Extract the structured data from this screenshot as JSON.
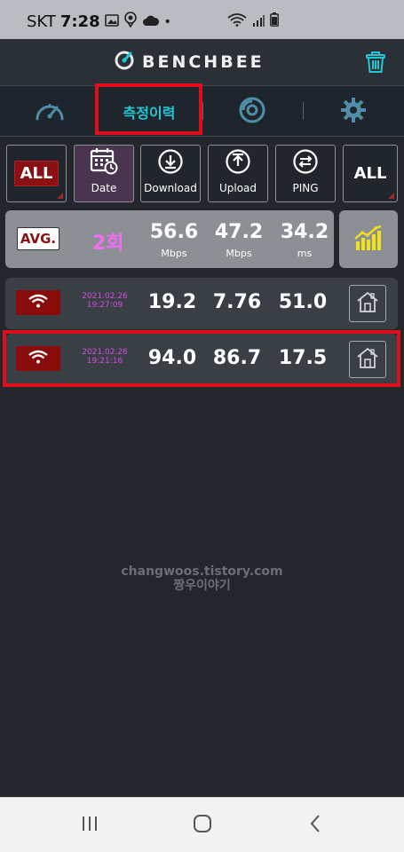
{
  "status_bar": {
    "carrier": "SKT",
    "time": "7:28",
    "dot": "•"
  },
  "app": {
    "logo_text": "BENCHBEE"
  },
  "tabs": {
    "history_label": "측정이력"
  },
  "filters": {
    "all_left": "ALL",
    "date": "Date",
    "download": "Download",
    "upload": "Upload",
    "ping": "PING",
    "all_right": "ALL"
  },
  "average": {
    "badge": "AVG.",
    "count": "2회",
    "download": "56.6",
    "upload": "47.2",
    "ping": "34.2",
    "download_unit": "Mbps",
    "upload_unit": "Mbps",
    "ping_unit": "ms"
  },
  "results": [
    {
      "date": "2021.02.26",
      "time": "19:27:09",
      "download": "19.2",
      "upload": "7.76",
      "ping": "51.0"
    },
    {
      "date": "2021.02.26",
      "time": "19:21:16",
      "download": "94.0",
      "upload": "86.7",
      "ping": "17.5"
    }
  ],
  "watermark": {
    "line1": "changwoos.tistory.com",
    "line2": "짱우이야기"
  },
  "colors": {
    "accent_cyan": "#22c7d6",
    "badge_red": "#8a0b0c",
    "count_pink": "#f06ef3",
    "highlight_red": "#e00e18",
    "graph_yellow": "#f2e21a"
  },
  "icons": {
    "gallery": "gallery-icon",
    "location": "location-icon",
    "cloud": "cloud-icon",
    "wifi_status": "wifi-status-icon",
    "signal": "signal-icon",
    "battery": "battery-icon",
    "logo": "benchbee-logo-icon",
    "trash": "trash-icon",
    "speedometer": "speedometer-icon",
    "disc": "disc-icon",
    "gear": "gear-icon",
    "calendar": "calendar-icon",
    "download": "download-icon",
    "upload": "upload-icon",
    "swap": "swap-icon",
    "graph": "graph-icon",
    "wifi": "wifi-icon",
    "home": "home-icon"
  }
}
